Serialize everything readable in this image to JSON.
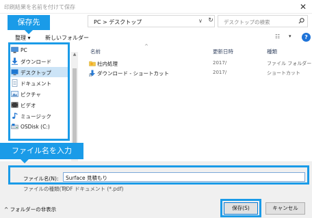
{
  "window": {
    "title": "印刷結果を名前を付けて保存",
    "close_glyph": "✕"
  },
  "address": {
    "path": "PC > デスクトップ",
    "dropdown_glyph": "∨",
    "refresh_glyph": "↻"
  },
  "search": {
    "placeholder": "デスクトップの検索",
    "icon": "search-icon"
  },
  "toolbar": {
    "organize": "整理",
    "organize_dd": "▾",
    "new_folder": "新しいフォルダー",
    "view_glyph": "☷",
    "view_dd": "▾",
    "help": "?"
  },
  "nav": {
    "items": [
      {
        "label": "PC",
        "icon": "pc-icon"
      },
      {
        "label": "ダウンロード",
        "icon": "download-icon"
      },
      {
        "label": "デスクトップ",
        "icon": "desktop-icon",
        "selected": true
      },
      {
        "label": "ドキュメント",
        "icon": "document-icon"
      },
      {
        "label": "ピクチャ",
        "icon": "picture-icon"
      },
      {
        "label": "ビデオ",
        "icon": "video-icon"
      },
      {
        "label": "ミュージック",
        "icon": "music-icon"
      },
      {
        "label": "OSDisk (C:)",
        "icon": "disk-icon"
      }
    ]
  },
  "list": {
    "columns": {
      "name": "名前",
      "date": "更新日時",
      "type": "種類"
    },
    "sort_glyph": "^",
    "rows": [
      {
        "name": "社内処理",
        "date": "2017/",
        "type": "ファイル フォルダー",
        "icon": "folder-icon"
      },
      {
        "name": "ダウンロード - ショートカット",
        "date": "2017/",
        "type": "ショートカット",
        "icon": "download-shortcut-icon"
      }
    ]
  },
  "form": {
    "filename_label": "ファイル名(N):",
    "filename_value": "Surface 見積もり",
    "filetype_label": "ファイルの種類(T):",
    "filetype_value": "PDF ドキュメント (*.pdf)"
  },
  "footer": {
    "hide_folders": "^ フォルダーの非表示",
    "save": "保存(S)",
    "cancel": "キャンセル"
  },
  "annotations": {
    "save_location": "保存先",
    "enter_filename": "ファイル名を入力",
    "color": "#1a9be8"
  }
}
